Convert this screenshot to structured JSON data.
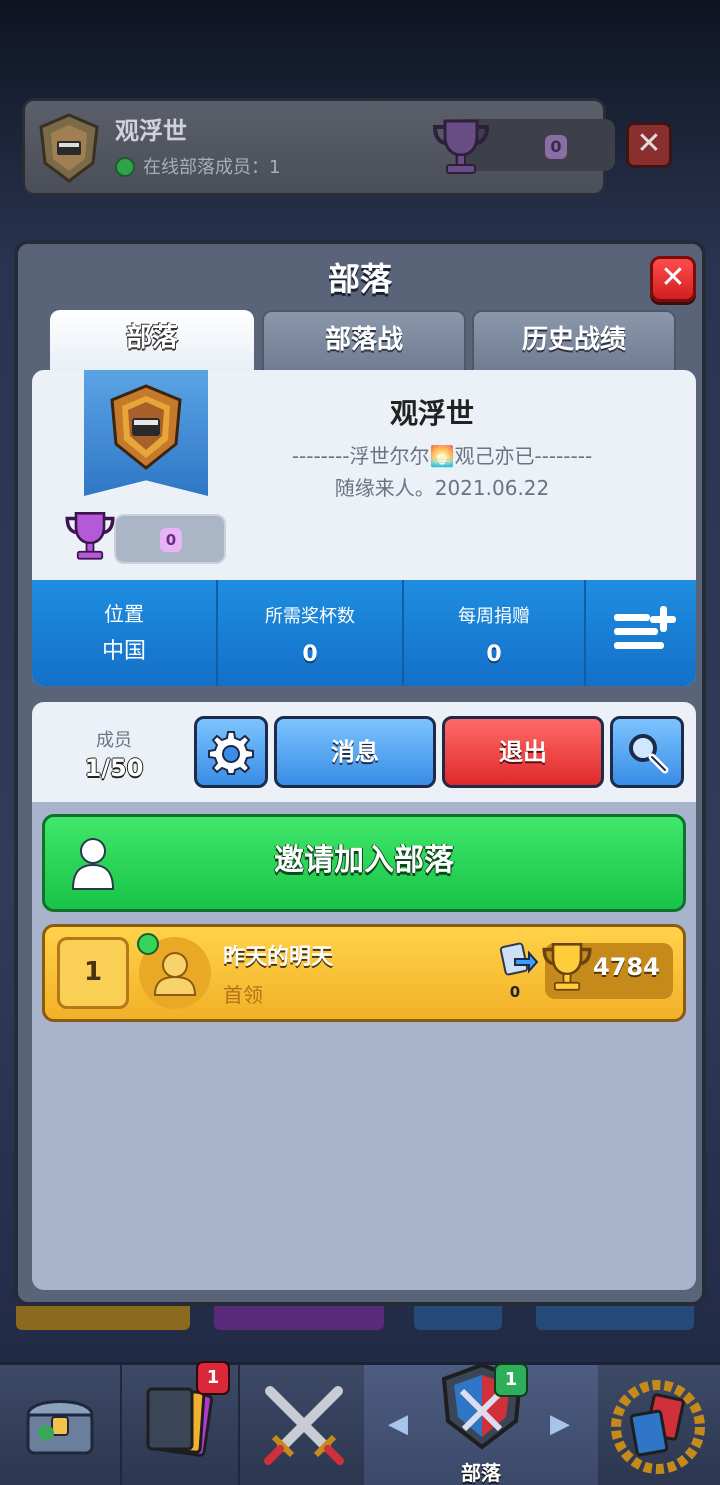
{
  "top_header": {
    "clan_name": "观浮世",
    "online_text": "在线部落成员：1",
    "trophies": "0"
  },
  "panel": {
    "title": "部落",
    "tabs": [
      {
        "label": "部落",
        "active": true
      },
      {
        "label": "部落战",
        "active": false
      },
      {
        "label": "历史战绩",
        "active": false
      }
    ]
  },
  "clan_card": {
    "name": "观浮世",
    "description_line1": "--------浮世尔尔🌅观己亦已--------",
    "description_line2": "随缘来人。2021.06.22",
    "clan_trophies": "0"
  },
  "stats": {
    "location_label": "位置",
    "location_value": "中国",
    "required_trophies_label": "所需奖杯数",
    "required_trophies_value": "0",
    "weekly_donations_label": "每周捐赠",
    "weekly_donations_value": "0"
  },
  "members_bar": {
    "label": "成员",
    "count": "1/50",
    "message_button": "消息",
    "exit_button": "退出"
  },
  "invite": {
    "label": "邀请加入部落"
  },
  "members": [
    {
      "rank": "1",
      "name": "昨天的明天",
      "role": "首领",
      "donations": "0",
      "trophies": "4784"
    }
  ],
  "bottom_nav": {
    "active_label": "部落",
    "cards_badge": "1",
    "clan_badge": "1"
  },
  "colors": {
    "accent_blue": "#1f8ee0",
    "invite_green": "#19c347",
    "exit_red": "#e02a2a",
    "member_gold": "#f2b128"
  }
}
